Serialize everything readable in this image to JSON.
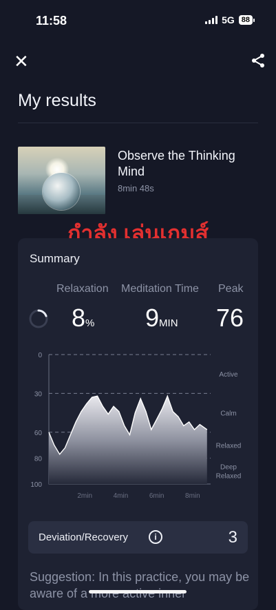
{
  "status_bar": {
    "time": "11:58",
    "network": "5G",
    "battery": "88"
  },
  "header": {
    "close_icon": "close-icon",
    "share_icon": "share-icon",
    "title": "My results"
  },
  "session": {
    "title": "Observe the Thinking Mind",
    "duration": "8min 48s"
  },
  "overlay_text": "กำลัง เล่นเกมส์",
  "summary": {
    "heading": "Summary",
    "stats": [
      {
        "label": "Relaxation",
        "value": "8",
        "unit": "%"
      },
      {
        "label": "Meditation Time",
        "value": "9",
        "unit": "MIN"
      },
      {
        "label": "Peak",
        "value": "76",
        "unit": ""
      }
    ],
    "deviation_label": "Deviation/Recovery",
    "deviation_value": "3",
    "suggestion": "Suggestion: In this practice, you may be aware of a more active inner"
  },
  "chart_data": {
    "type": "area",
    "x_unit": "min",
    "x_ticks": [
      "2min",
      "4min",
      "6min",
      "8min"
    ],
    "y_ticks": [
      "0",
      "30",
      "60",
      "80",
      "100"
    ],
    "ylim": [
      0,
      100
    ],
    "y_inverted": true,
    "zones": [
      "Active",
      "Calm",
      "Relaxed",
      "Deep Relaxed"
    ],
    "x": [
      0,
      0.3,
      0.6,
      0.9,
      1.2,
      1.5,
      1.8,
      2.1,
      2.4,
      2.7,
      3.0,
      3.3,
      3.6,
      3.9,
      4.2,
      4.5,
      4.8,
      5.1,
      5.4,
      5.7,
      6.0,
      6.3,
      6.6,
      6.9,
      7.2,
      7.5,
      7.8,
      8.1,
      8.4,
      8.8
    ],
    "values": [
      60,
      70,
      77,
      72,
      62,
      52,
      44,
      38,
      33,
      32,
      40,
      46,
      40,
      44,
      55,
      62,
      45,
      34,
      44,
      58,
      50,
      42,
      32,
      44,
      48,
      55,
      52,
      58,
      54,
      58
    ]
  },
  "colors": {
    "background": "#151826",
    "card": "#1e2232",
    "accent_text": "#e23030"
  }
}
